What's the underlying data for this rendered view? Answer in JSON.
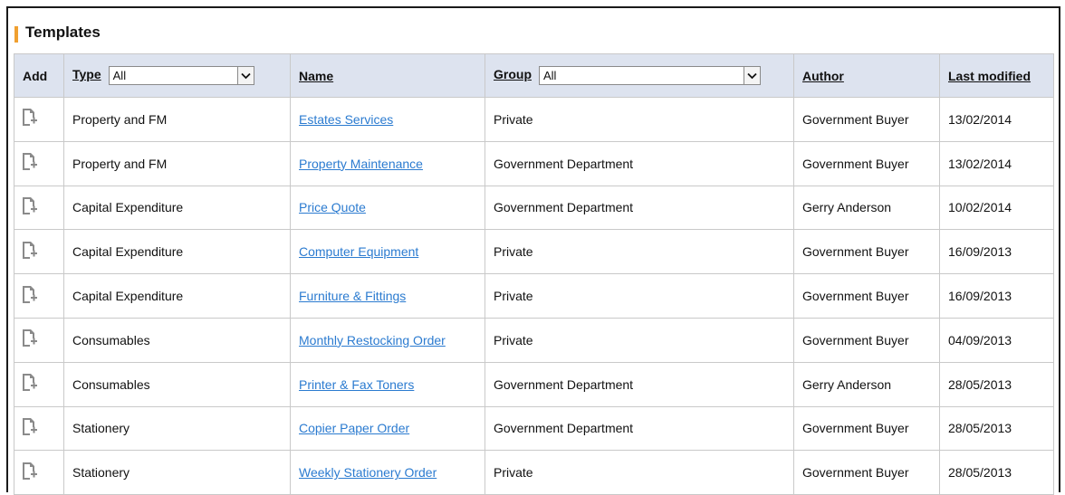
{
  "panel": {
    "title": "Templates"
  },
  "table": {
    "headers": {
      "add": "Add",
      "type": "Type",
      "name": "Name",
      "group": "Group",
      "author": "Author",
      "last_modified": "Last modified"
    },
    "filters": {
      "type_value": "All",
      "group_value": "All"
    },
    "rows": [
      {
        "type": "Property and FM",
        "name": "Estates Services",
        "group": "Private",
        "author": "Government Buyer",
        "modified": "13/02/2014"
      },
      {
        "type": "Property and FM",
        "name": "Property Maintenance",
        "group": "Government Department",
        "author": "Government Buyer",
        "modified": "13/02/2014"
      },
      {
        "type": "Capital Expenditure",
        "name": "Price Quote",
        "group": "Government Department",
        "author": "Gerry Anderson",
        "modified": "10/02/2014"
      },
      {
        "type": "Capital Expenditure",
        "name": "Computer Equipment",
        "group": "Private",
        "author": "Government Buyer",
        "modified": "16/09/2013"
      },
      {
        "type": "Capital Expenditure",
        "name": "Furniture & Fittings",
        "group": "Private",
        "author": "Government Buyer",
        "modified": "16/09/2013"
      },
      {
        "type": "Consumables",
        "name": "Monthly Restocking Order",
        "group": "Private",
        "author": "Government Buyer",
        "modified": "04/09/2013"
      },
      {
        "type": "Consumables",
        "name": "Printer & Fax Toners",
        "group": "Government Department",
        "author": "Gerry Anderson",
        "modified": "28/05/2013"
      },
      {
        "type": "Stationery",
        "name": "Copier Paper Order",
        "group": "Government Department",
        "author": "Government Buyer",
        "modified": "28/05/2013"
      },
      {
        "type": "Stationery",
        "name": "Weekly Stationery Order",
        "group": "Private",
        "author": "Government Buyer",
        "modified": "28/05/2013"
      }
    ]
  },
  "icons": {
    "add_row": "add-document-icon",
    "select_arrow": "chevron-down-icon"
  },
  "colors": {
    "accent": "#f0a030",
    "link": "#2b7bd0",
    "header_bg": "#dde3ef",
    "icon": "#8a8a8a"
  }
}
